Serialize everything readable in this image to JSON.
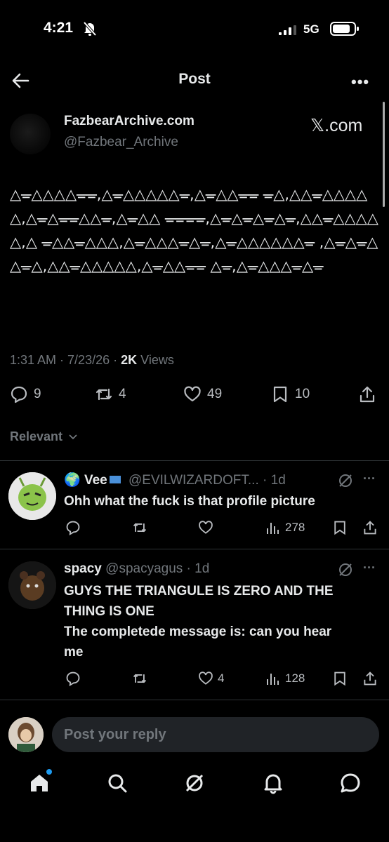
{
  "status_bar": {
    "time": "4:21",
    "network": "5G"
  },
  "header": {
    "title": "Post"
  },
  "post": {
    "author_name": "FazbearArchive.com",
    "author_handle": "@Fazbear_Archive",
    "source_label": "𝕏.com",
    "body": "△ᚚ△△△△ᚚᚚ,△ᚚ△△△△△ᚚ,△ᚚ△△ᚚᚚ ᚚ△,△△ᚚ△△△△△,△ᚚ△ᚚᚚ△△ᚚ,△ᚚ△△ ᚚᚚᚚᚚ,△ᚚ△ᚚ△ᚚ△ᚚ,△△ᚚ△△△△△,△ ᚚ△△ᚚ△△△,△ᚚ△△△ᚚ△ᚚ,△ᚚ△△△△△△ᚚ ,△ᚚ△ᚚ△△ᚚ△,△△ᚚ△△△△△,△ᚚ△△ᚚᚚ △ᚚ,△ᚚ△△△ᚚ△ᚚ",
    "time": "1:31 AM",
    "date": "7/23/26",
    "views_count": "2K",
    "views_label": "Views",
    "replies": "9",
    "reposts": "4",
    "likes": "49",
    "bookmarks": "10"
  },
  "sort": {
    "label": "Relevant"
  },
  "replies": [
    {
      "name": "Vee",
      "handle": "@EVILWIZARDOFT...",
      "age": "1d",
      "text": "Ohh what the fuck is that profile picture",
      "replies": "",
      "reposts": "",
      "likes": "",
      "views": "278"
    },
    {
      "name": "spacy",
      "handle": "@spacyagus",
      "age": "1d",
      "text": "GUYS THE TRIANGULE IS ZERO AND THE THING IS ONE\nThe completede message is: can you hear me",
      "text_line1": "GUYS THE TRIANGULE IS ZERO AND THE",
      "text_line2": "THING IS ONE",
      "text_line3": "The completede message is: can you hear",
      "text_line4": "me",
      "replies": "",
      "reposts": "",
      "likes": "4",
      "views": "128"
    }
  ],
  "composer": {
    "placeholder": "Post your reply"
  },
  "colors": {
    "background": "#000000",
    "text": "#e7e9ea",
    "muted": "#71767b",
    "accent": "#1d9bf0"
  }
}
